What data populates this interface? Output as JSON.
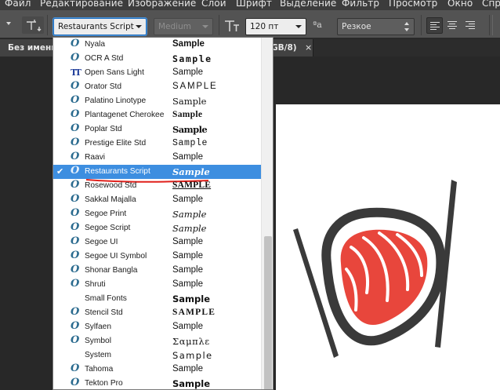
{
  "menu": {
    "items": [
      {
        "label": "Файл"
      },
      {
        "label": "Редактирование"
      },
      {
        "label": "Изображение"
      },
      {
        "label": "Слои"
      },
      {
        "label": "Шрифт"
      },
      {
        "label": "Выделение"
      },
      {
        "label": "Фильтр"
      },
      {
        "label": "Просмотр"
      },
      {
        "label": "Окно"
      },
      {
        "label": "Спр"
      }
    ]
  },
  "options_bar": {
    "font_family": "Restaurants Script",
    "font_style": "Medium",
    "font_size": "120 пт",
    "aa_icon": "ªa",
    "antialias": "Резкое"
  },
  "document_tab": {
    "name": "Без имени",
    "mode": "GB/8)",
    "close": "×"
  },
  "font_list": {
    "selected": "Restaurants Script",
    "items": [
      {
        "name": "Nyala",
        "sample": "Sample",
        "icon": "opentype-icon"
      },
      {
        "name": "OCR A Std",
        "sample": "Sample",
        "icon": "opentype-icon"
      },
      {
        "name": "Open Sans Light",
        "sample": "Sample",
        "icon": "truetype-icon"
      },
      {
        "name": "Orator Std",
        "sample": "SAMPLE",
        "icon": "opentype-icon"
      },
      {
        "name": "Palatino Linotype",
        "sample": "Sample",
        "icon": "opentype-icon"
      },
      {
        "name": "Plantagenet Cherokee",
        "sample": "Sample",
        "icon": "opentype-icon"
      },
      {
        "name": "Poplar Std",
        "sample": "Sample",
        "icon": "opentype-icon"
      },
      {
        "name": "Prestige Elite Std",
        "sample": "Sample",
        "icon": "opentype-icon"
      },
      {
        "name": "Raavi",
        "sample": "Sample",
        "icon": "opentype-icon"
      },
      {
        "name": "Restaurants Script",
        "sample": "Sample",
        "icon": "opentype-icon"
      },
      {
        "name": "Rosewood Std",
        "sample": "SAMPLE",
        "icon": "opentype-icon"
      },
      {
        "name": "Sakkal Majalla",
        "sample": "Sample",
        "icon": "opentype-icon"
      },
      {
        "name": "Segoe Print",
        "sample": "Sample",
        "icon": "opentype-icon"
      },
      {
        "name": "Segoe Script",
        "sample": "Sample",
        "icon": "opentype-icon"
      },
      {
        "name": "Segoe UI",
        "sample": "Sample",
        "icon": "opentype-icon"
      },
      {
        "name": "Segoe UI Symbol",
        "sample": "Sample",
        "icon": "opentype-icon"
      },
      {
        "name": "Shonar Bangla",
        "sample": "Sample",
        "icon": "opentype-icon"
      },
      {
        "name": "Shruti",
        "sample": "Sample",
        "icon": "opentype-icon"
      },
      {
        "name": "Small Fonts",
        "sample": "Sample",
        "icon": "none"
      },
      {
        "name": "Stencil Std",
        "sample": "SAMPLE",
        "icon": "opentype-icon"
      },
      {
        "name": "Sylfaen",
        "sample": "Sample",
        "icon": "opentype-icon"
      },
      {
        "name": "Symbol",
        "sample": "Σαμπλε",
        "icon": "opentype-icon"
      },
      {
        "name": "System",
        "sample": "Sample",
        "icon": "none"
      },
      {
        "name": "Tahoma",
        "sample": "Sample",
        "icon": "opentype-icon"
      },
      {
        "name": "Tekton Pro",
        "sample": "Sample",
        "icon": "opentype-icon"
      }
    ]
  },
  "colors": {
    "selection": "#3d8ee0",
    "salmon": "#e8463c",
    "ring": "#3a3a3a",
    "annotation": "#e0201b"
  }
}
